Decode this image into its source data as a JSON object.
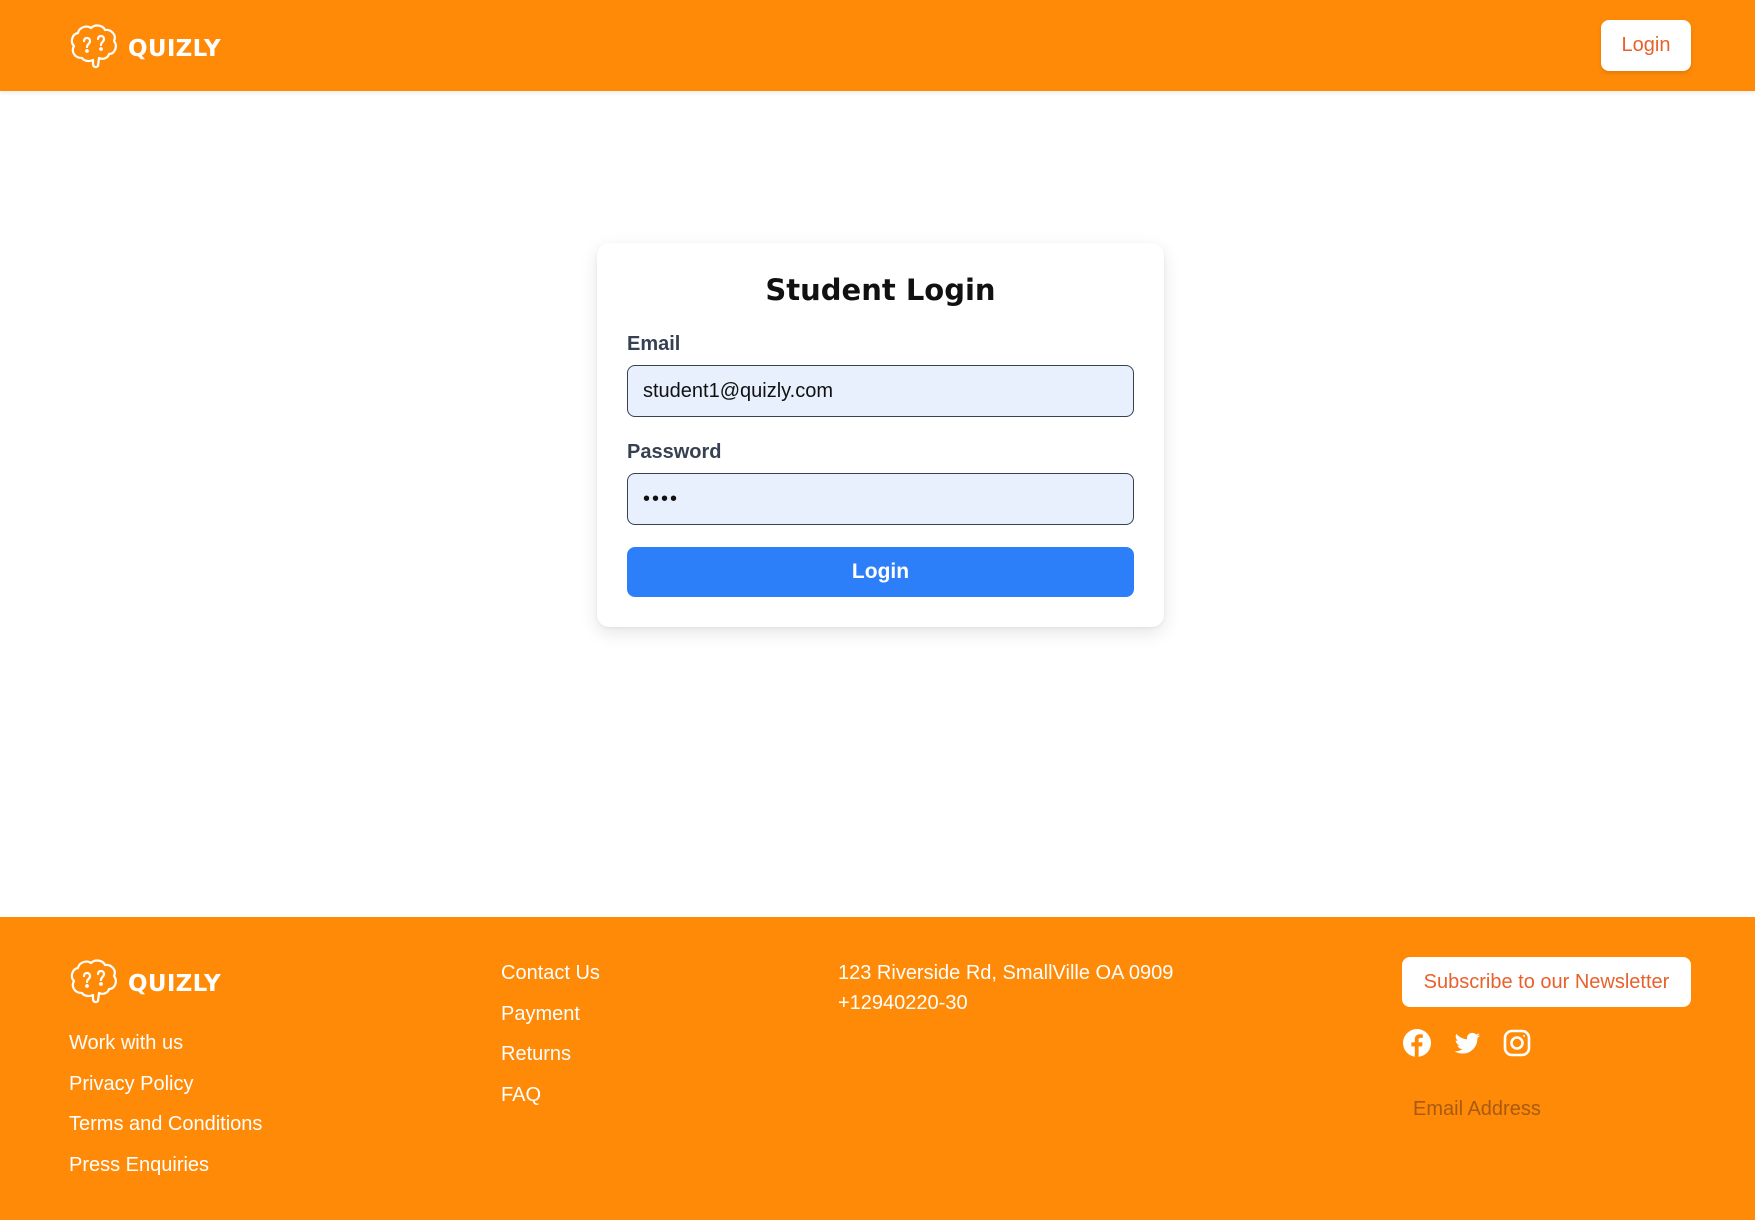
{
  "brand": {
    "name": "QUIZLY",
    "logo_icon": "brain-question-icon"
  },
  "header": {
    "login_label": "Login"
  },
  "login_form": {
    "title": "Student Login",
    "email_label": "Email",
    "email_value": "student1@quizly.com",
    "password_label": "Password",
    "password_value": "1234",
    "submit_label": "Login"
  },
  "footer": {
    "links_col1": [
      "Work with us",
      "Privacy Policy",
      "Terms and Conditions",
      "Press Enquiries"
    ],
    "links_col2": [
      "Contact Us",
      "Payment",
      "Returns",
      "FAQ"
    ],
    "address": "123 Riverside Rd, SmallVille OA 0909",
    "phone": "+12940220-30",
    "subscribe_label": "Subscribe to our Newsletter",
    "social_icons": [
      "facebook-icon",
      "twitter-icon",
      "instagram-icon"
    ],
    "newsletter_placeholder": "Email Address"
  },
  "colors": {
    "brand_orange": "#ff8a08",
    "button_blue": "#2d7ff9",
    "accent_text": "#e8612c",
    "input_bg": "#e8f0fe"
  }
}
